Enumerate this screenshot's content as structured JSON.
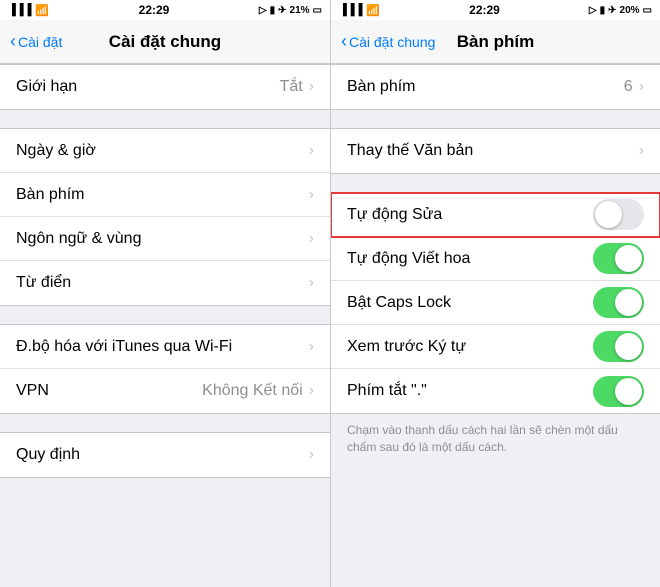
{
  "left_panel": {
    "status": {
      "time": "22:29",
      "signal_icon": "signal-icon",
      "wifi_icon": "wifi-icon",
      "battery_pct": "21%",
      "battery_icon": "battery-icon",
      "airplane_icon": "airplane-icon",
      "location_icon": "location-icon",
      "alarm_icon": "alarm-icon"
    },
    "nav": {
      "back_label": "Cài đặt",
      "title": "Cài đặt chung"
    },
    "items": [
      {
        "label": "Giới hạn",
        "value": "Tắt",
        "has_chevron": true
      },
      {
        "label": "Ngày & giờ",
        "value": "",
        "has_chevron": true
      },
      {
        "label": "Bàn phím",
        "value": "",
        "has_chevron": true
      },
      {
        "label": "Ngôn ngữ & vùng",
        "value": "",
        "has_chevron": true
      },
      {
        "label": "Từ điển",
        "value": "",
        "has_chevron": true
      },
      {
        "label": "Đ.bộ hóa với iTunes qua Wi-Fi",
        "value": "",
        "has_chevron": true
      },
      {
        "label": "VPN",
        "value": "Không Kết nối",
        "has_chevron": true
      },
      {
        "label": "Quy định",
        "value": "",
        "has_chevron": true
      }
    ]
  },
  "right_panel": {
    "status": {
      "time": "22:29",
      "signal_icon": "signal-icon",
      "wifi_icon": "wifi-icon",
      "battery_pct": "20%",
      "battery_icon": "battery-icon",
      "airplane_icon": "airplane-icon",
      "location_icon": "location-icon",
      "alarm_icon": "alarm-icon"
    },
    "nav": {
      "back_label": "Cài đặt chung",
      "title": "Bàn phím"
    },
    "keyboard_row": {
      "label": "Bàn phím",
      "count": "6",
      "has_chevron": true
    },
    "items": [
      {
        "label": "Thay thế Văn bản",
        "has_chevron": true,
        "toggle": null
      },
      {
        "label": "Tự động Sửa",
        "has_chevron": false,
        "toggle": "off",
        "highlighted": true
      },
      {
        "label": "Tự động Viết hoa",
        "has_chevron": false,
        "toggle": "on"
      },
      {
        "label": "Bật Caps Lock",
        "has_chevron": false,
        "toggle": "on"
      },
      {
        "label": "Xem trước Ký tự",
        "has_chevron": false,
        "toggle": "on"
      },
      {
        "label": "Phím tắt \".\"",
        "has_chevron": false,
        "toggle": "on"
      }
    ],
    "footer": "Chạm vào thanh dấu cách hai lần sẽ chèn một dấu chấm sau đó là một dấu cách."
  }
}
